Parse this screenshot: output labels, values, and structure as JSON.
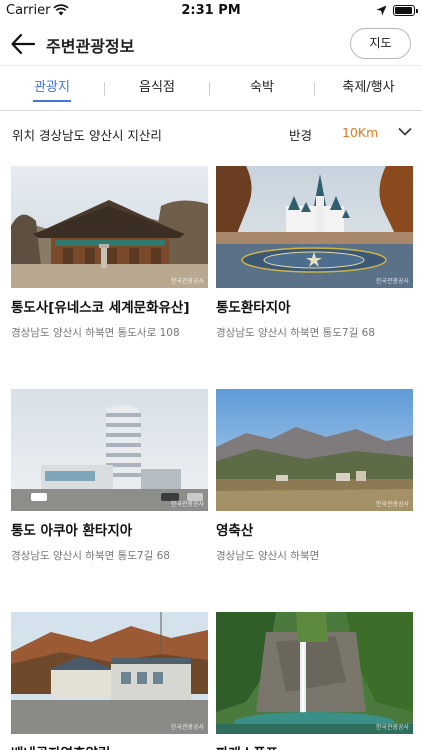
{
  "status_bar": {
    "carrier": "Carrier",
    "time": "2:31 PM"
  },
  "header": {
    "title": "주변관광정보",
    "map_button": "지도"
  },
  "tabs": [
    {
      "label": "관광지",
      "active": true
    },
    {
      "label": "음식점",
      "active": false
    },
    {
      "label": "숙박",
      "active": false
    },
    {
      "label": "축제/행사",
      "active": false
    }
  ],
  "filter": {
    "location": "위치 경상남도 양산시 지산리",
    "radius_label": "반경",
    "radius_value": "10Km"
  },
  "places": [
    {
      "title": "통도사[유네스코 세계문화유산]",
      "address": "경상남도 양산시 하북면 통도사로 108"
    },
    {
      "title": "통도환타지아",
      "address": "경상남도 양산시 하북면 통도7길 68"
    },
    {
      "title": "통도 아쿠아 환타지아",
      "address": "경상남도 양산시 하북면 통도7길 68"
    },
    {
      "title": "영축산",
      "address": "경상남도 양산시 하북면"
    },
    {
      "title": "배내골자연휴양림",
      "address": ""
    },
    {
      "title": "파래소폭포",
      "address": ""
    }
  ],
  "colors": {
    "accent": "#4276d4",
    "radius": "#e07a1f"
  }
}
